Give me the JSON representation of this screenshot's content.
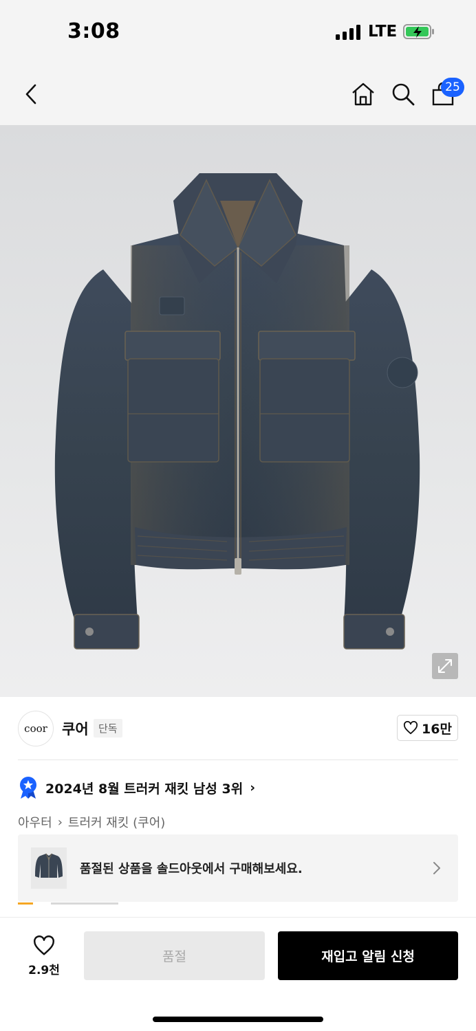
{
  "status_bar": {
    "time": "3:08",
    "network": "LTE",
    "battery_color": "#34c759"
  },
  "header": {
    "back_icon": "chevron-left-icon",
    "home_icon": "home-icon",
    "search_icon": "search-icon",
    "cart_icon": "shopping-bag-icon",
    "cart_badge": "25",
    "badge_color": "#1a62ff"
  },
  "product_image": {
    "expand_icon": "expand-icon"
  },
  "brand": {
    "logo_text": "coor",
    "name": "쿠어",
    "tag": "단독",
    "likes": "16만",
    "like_icon": "heart-outline-icon"
  },
  "ranking": {
    "icon": "ranking-medal-icon",
    "text": "2024년 8월 트러커 재킷 남성 3위",
    "chevron": "›",
    "medal_color": "#1a62ff"
  },
  "breadcrumb": {
    "items": [
      "아우터",
      "트러커 재킷 (쿠어)"
    ],
    "separator": "›"
  },
  "soldout_banner": {
    "text": "품절된 상품을 솔드아웃에서 구매해보세요.",
    "chevron_icon": "chevron-right-icon"
  },
  "bottom_bar": {
    "wish_icon": "heart-outline-icon",
    "wish_count": "2.9천",
    "soldout_label": "품절",
    "restock_label": "재입고 알림 신청"
  }
}
